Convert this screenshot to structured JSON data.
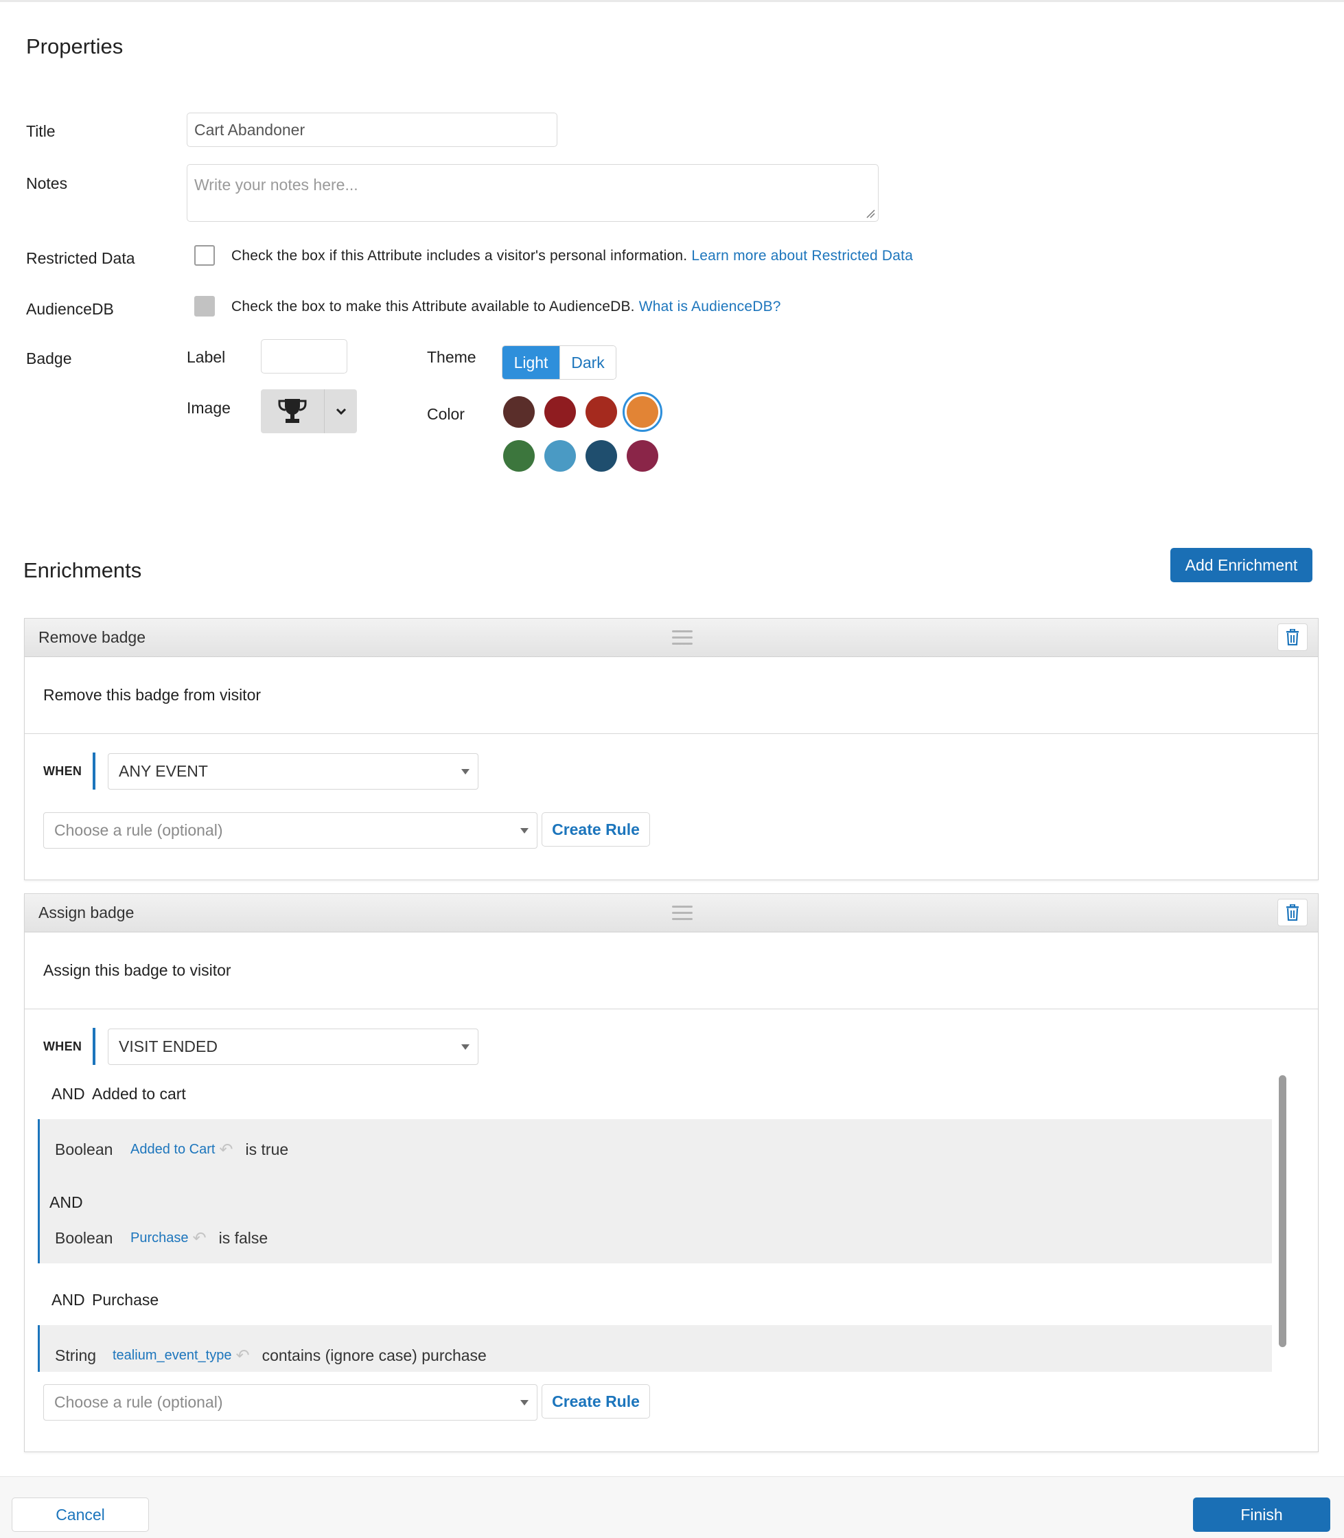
{
  "properties": {
    "heading": "Properties",
    "title_label": "Title",
    "title_value": "Cart Abandoner",
    "notes_label": "Notes",
    "notes_placeholder": "Write your notes here...",
    "restricted_label": "Restricted Data",
    "restricted_help": "Check the box if this Attribute includes a visitor's personal information.",
    "restricted_link": "Learn more about Restricted Data",
    "audiencedb_label": "AudienceDB",
    "audiencedb_help": "Check the box to make this Attribute available to AudienceDB.",
    "audiencedb_link": "What is AudienceDB?",
    "badge_label": "Badge",
    "badge_sub_label": "Label",
    "badge_label_value": "",
    "image_label": "Image",
    "image_icon": "trophy-icon",
    "theme_label": "Theme",
    "theme_options": [
      "Light",
      "Dark"
    ],
    "theme_selected": "Light",
    "color_label": "Color",
    "colors": [
      "#5a2e2a",
      "#8f1c20",
      "#a52a1e",
      "#e28435",
      "#3c763d",
      "#4a9ac4",
      "#1f4e6e",
      "#8a2548"
    ],
    "color_selected": "#e28435"
  },
  "enrichments": {
    "heading": "Enrichments",
    "add_button": "Add Enrichment",
    "items": [
      {
        "title": "Remove badge",
        "description": "Remove this badge from visitor",
        "when_label": "WHEN",
        "event": "ANY EVENT",
        "rule_placeholder": "Choose a rule (optional)",
        "create_rule": "Create Rule"
      },
      {
        "title": "Assign badge",
        "description": "Assign this badge to visitor",
        "when_label": "WHEN",
        "event": "VISIT ENDED",
        "rule_groups": [
          {
            "heading_and": "AND",
            "heading_name": "Added to cart",
            "conditions": [
              {
                "type": "Boolean",
                "variable": "Added to Cart",
                "operator": "is true"
              },
              {
                "connector": "AND"
              },
              {
                "type": "Boolean",
                "variable": "Purchase",
                "operator": "is false"
              }
            ]
          },
          {
            "heading_and": "AND",
            "heading_name": "Purchase",
            "conditions": [
              {
                "type": "String",
                "variable": "tealium_event_type",
                "operator": "contains (ignore case) purchase"
              }
            ]
          }
        ],
        "rule_placeholder": "Choose a rule (optional)",
        "create_rule": "Create Rule"
      }
    ]
  },
  "footer": {
    "cancel": "Cancel",
    "finish": "Finish"
  }
}
